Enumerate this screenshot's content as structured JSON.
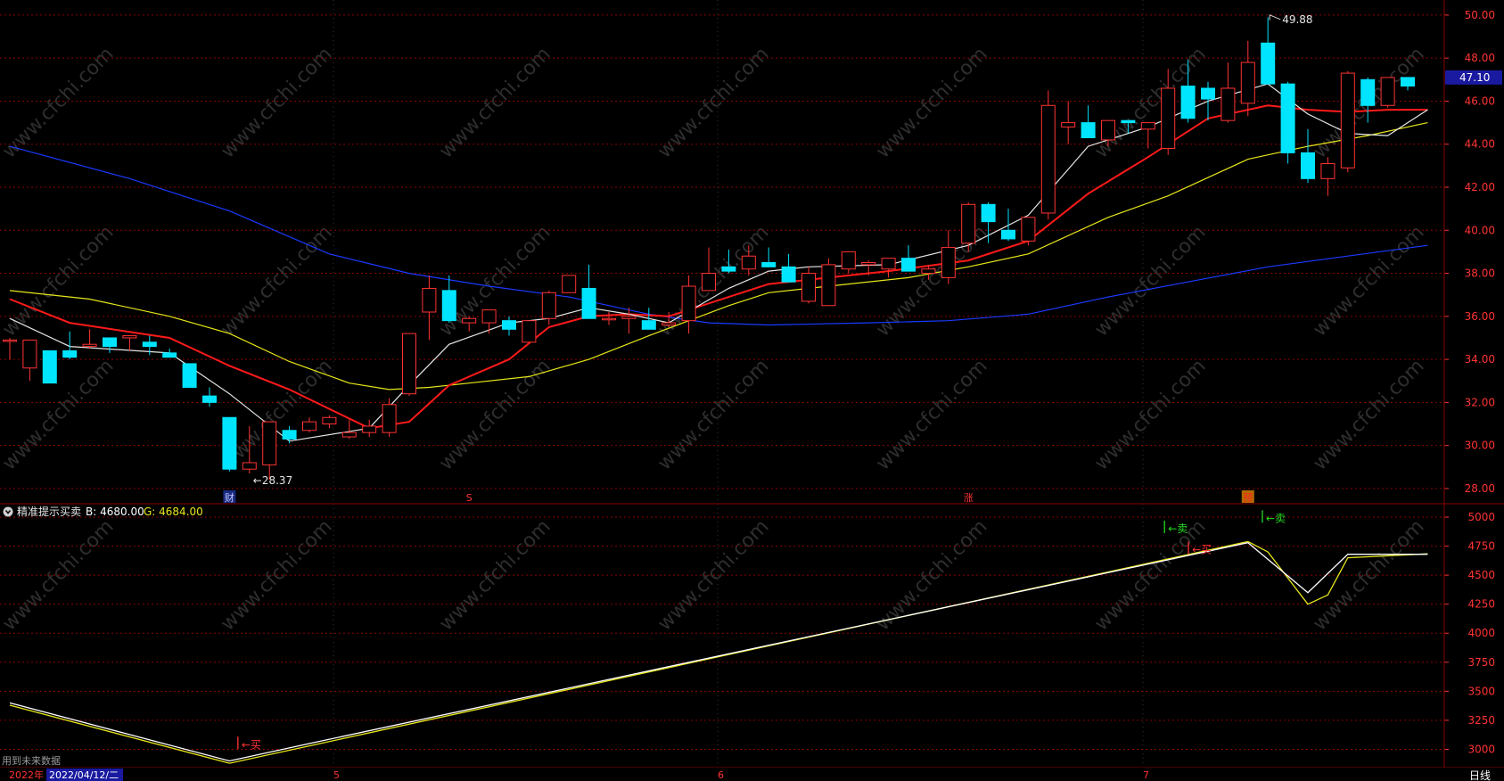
{
  "indicator": {
    "name": "精准提示买卖",
    "b_label": "B: 4680.00",
    "g_label": "G: 4684.00",
    "future_note": "用到未来数据"
  },
  "time_bar": {
    "year": "2022年",
    "cursor_date": "2022/04/12/二",
    "period": "日线",
    "months": [
      "5",
      "6",
      "7"
    ]
  },
  "price_panel": {
    "yticks": [
      "50.00",
      "48.00",
      "46.00",
      "44.00",
      "42.00",
      "40.00",
      "38.00",
      "36.00",
      "34.00",
      "32.00",
      "30.00",
      "28.00"
    ],
    "current_price": "47.10",
    "high_label": "49.88",
    "low_label": "←28.37",
    "markers": [
      "财",
      "S",
      "涨",
      "预"
    ]
  },
  "indicator_panel": {
    "yticks": [
      "5000",
      "4750",
      "4500",
      "4250",
      "4000",
      "3750",
      "3500",
      "3250",
      "3000"
    ],
    "signals": [
      {
        "text": "←买",
        "color": "#ff3333"
      },
      {
        "text": "←卖",
        "color": "#22dd22"
      },
      {
        "text": "←卖",
        "color": "#22dd22"
      },
      {
        "text": "←买",
        "color": "#ff3333"
      }
    ]
  },
  "watermark": "www.cfchi.com",
  "colors": {
    "up": "#ff3333",
    "down": "#00e5ff",
    "ma_white": "#e6e6e6",
    "ma_red": "#ff1a1a",
    "ma_yellow": "#e6e61a",
    "ma_blue": "#1a3aff",
    "grid": "#8b0000",
    "axis_text": "#ff3333",
    "b_line": "#ffffff",
    "g_line": "#e6e61a"
  },
  "chart_data": [
    {
      "type": "candlestick",
      "title": "",
      "ylim": [
        27.5,
        50.7
      ],
      "candles_ohlc": [
        [
          34.9,
          35.0,
          34.0,
          34.9
        ],
        [
          33.6,
          34.7,
          33.0,
          34.9
        ],
        [
          34.4,
          34.4,
          32.9,
          32.9
        ],
        [
          34.4,
          35.3,
          34.0,
          34.1
        ],
        [
          34.6,
          35.4,
          34.5,
          34.7
        ],
        [
          35.0,
          35.0,
          34.3,
          34.6
        ],
        [
          35.0,
          35.1,
          34.4,
          35.1
        ],
        [
          34.8,
          35.1,
          34.2,
          34.6
        ],
        [
          34.3,
          34.5,
          34.1,
          34.1
        ],
        [
          33.8,
          33.8,
          32.7,
          32.7
        ],
        [
          32.3,
          32.7,
          31.8,
          32.0
        ],
        [
          31.3,
          31.3,
          28.8,
          28.9
        ],
        [
          28.9,
          30.9,
          28.7,
          29.2
        ],
        [
          29.1,
          31.1,
          28.4,
          31.1
        ],
        [
          30.7,
          30.9,
          30.1,
          30.3
        ],
        [
          30.7,
          31.3,
          30.6,
          31.1
        ],
        [
          31.0,
          31.4,
          30.8,
          31.3
        ],
        [
          30.4,
          31.2,
          30.3,
          30.6
        ],
        [
          30.6,
          31.2,
          30.4,
          30.9
        ],
        [
          30.6,
          32.2,
          30.4,
          31.9
        ],
        [
          32.4,
          35.2,
          32.3,
          35.2
        ],
        [
          36.2,
          37.9,
          34.9,
          37.3
        ],
        [
          37.2,
          37.9,
          35.7,
          35.8
        ],
        [
          35.7,
          36.0,
          35.3,
          35.9
        ],
        [
          35.7,
          36.2,
          35.2,
          36.3
        ],
        [
          35.8,
          36.0,
          35.1,
          35.4
        ],
        [
          34.8,
          35.8,
          34.8,
          35.8
        ],
        [
          35.9,
          37.2,
          35.6,
          37.1
        ],
        [
          37.1,
          37.9,
          37.1,
          37.9
        ],
        [
          37.3,
          38.4,
          35.9,
          35.9
        ],
        [
          35.9,
          36.2,
          35.6,
          35.9
        ],
        [
          35.9,
          36.4,
          35.2,
          36.0
        ],
        [
          35.8,
          36.4,
          35.4,
          35.4
        ],
        [
          35.6,
          36.2,
          35.5,
          35.7
        ],
        [
          35.8,
          37.9,
          35.2,
          37.4
        ],
        [
          37.2,
          39.2,
          37.2,
          38.0
        ],
        [
          38.3,
          39.1,
          38.0,
          38.1
        ],
        [
          38.2,
          39.3,
          37.9,
          38.8
        ],
        [
          38.5,
          39.2,
          38.3,
          38.3
        ],
        [
          38.3,
          38.9,
          37.6,
          37.6
        ],
        [
          36.7,
          38.3,
          36.6,
          38.0
        ],
        [
          36.5,
          38.7,
          36.5,
          38.4
        ],
        [
          38.2,
          39.0,
          38.0,
          39.0
        ],
        [
          38.4,
          38.6,
          37.9,
          38.5
        ],
        [
          38.2,
          38.6,
          37.8,
          38.7
        ],
        [
          38.7,
          39.3,
          38.1,
          38.1
        ],
        [
          38.0,
          38.4,
          37.7,
          38.2
        ],
        [
          37.8,
          40.0,
          37.5,
          39.2
        ],
        [
          39.4,
          41.3,
          39.0,
          41.2
        ],
        [
          41.2,
          41.3,
          39.4,
          40.4
        ],
        [
          40.0,
          41.0,
          39.5,
          39.6
        ],
        [
          39.5,
          40.6,
          39.3,
          40.6
        ],
        [
          40.8,
          46.5,
          40.5,
          45.8
        ],
        [
          44.8,
          46.0,
          44.0,
          45.0
        ],
        [
          45.0,
          45.8,
          44.3,
          44.3
        ],
        [
          44.2,
          45.1,
          43.9,
          45.1
        ],
        [
          45.1,
          45.1,
          44.5,
          45.0
        ],
        [
          44.7,
          44.9,
          43.8,
          45.0
        ],
        [
          43.8,
          47.5,
          43.5,
          46.6
        ],
        [
          46.7,
          47.9,
          45.0,
          45.2
        ],
        [
          46.6,
          46.9,
          45.1,
          46.1
        ],
        [
          45.1,
          47.8,
          45.0,
          46.6
        ],
        [
          45.9,
          48.8,
          45.3,
          47.8
        ],
        [
          48.7,
          49.9,
          46.8,
          46.8
        ],
        [
          46.8,
          46.9,
          43.1,
          43.6
        ],
        [
          43.6,
          44.7,
          42.2,
          42.4
        ],
        [
          42.4,
          43.4,
          41.6,
          43.1
        ],
        [
          42.9,
          47.4,
          42.7,
          47.3
        ],
        [
          47.0,
          47.1,
          45.0,
          45.8
        ],
        [
          45.8,
          47.1,
          45.7,
          47.1
        ],
        [
          47.1,
          47.1,
          46.5,
          46.7
        ]
      ],
      "ma_white": [
        [
          0,
          35.9
        ],
        [
          3,
          34.6
        ],
        [
          8,
          34.3
        ],
        [
          11,
          32.4
        ],
        [
          14,
          30.2
        ],
        [
          18,
          30.8
        ],
        [
          20,
          32.8
        ],
        [
          22,
          34.7
        ],
        [
          25,
          35.7
        ],
        [
          27,
          35.9
        ],
        [
          29,
          36.4
        ],
        [
          31,
          36.1
        ],
        [
          33,
          35.7
        ],
        [
          36,
          37.3
        ],
        [
          38,
          38.1
        ],
        [
          40,
          38.3
        ],
        [
          44,
          38.4
        ],
        [
          48,
          39.3
        ],
        [
          51,
          40.7
        ],
        [
          54,
          43.9
        ],
        [
          57,
          44.8
        ],
        [
          60,
          46.0
        ],
        [
          63,
          46.8
        ],
        [
          65,
          45.4
        ],
        [
          67,
          44.5
        ],
        [
          69,
          44.4
        ],
        [
          71,
          45.6
        ]
      ],
      "ma_red": [
        [
          0,
          36.8
        ],
        [
          3,
          35.7
        ],
        [
          8,
          35.0
        ],
        [
          11,
          33.7
        ],
        [
          14,
          32.6
        ],
        [
          18,
          30.8
        ],
        [
          20,
          31.1
        ],
        [
          22,
          32.8
        ],
        [
          25,
          34.0
        ],
        [
          27,
          35.5
        ],
        [
          29,
          36.0
        ],
        [
          31,
          36.1
        ],
        [
          33,
          36.0
        ],
        [
          36,
          36.9
        ],
        [
          38,
          37.5
        ],
        [
          40,
          37.7
        ],
        [
          44,
          38.1
        ],
        [
          48,
          38.6
        ],
        [
          51,
          39.5
        ],
        [
          54,
          41.7
        ],
        [
          57,
          43.4
        ],
        [
          60,
          45.2
        ],
        [
          63,
          45.8
        ],
        [
          65,
          45.6
        ],
        [
          67,
          45.5
        ],
        [
          69,
          45.6
        ],
        [
          71,
          45.6
        ]
      ],
      "ma_yellow": [
        [
          0,
          37.2
        ],
        [
          4,
          36.8
        ],
        [
          8,
          36.0
        ],
        [
          11,
          35.2
        ],
        [
          14,
          33.9
        ],
        [
          17,
          32.9
        ],
        [
          19,
          32.6
        ],
        [
          21,
          32.7
        ],
        [
          23,
          32.9
        ],
        [
          26,
          33.2
        ],
        [
          29,
          34.0
        ],
        [
          32,
          35.1
        ],
        [
          34,
          35.8
        ],
        [
          36,
          36.5
        ],
        [
          38,
          37.1
        ],
        [
          41,
          37.4
        ],
        [
          45,
          37.8
        ],
        [
          48,
          38.3
        ],
        [
          51,
          38.9
        ],
        [
          55,
          40.6
        ],
        [
          58,
          41.6
        ],
        [
          62,
          43.3
        ],
        [
          65,
          43.9
        ],
        [
          68,
          44.4
        ],
        [
          71,
          45.0
        ]
      ],
      "ma_blue": [
        [
          0,
          43.9
        ],
        [
          6,
          42.4
        ],
        [
          11,
          40.9
        ],
        [
          16,
          38.9
        ],
        [
          20,
          38.0
        ],
        [
          24,
          37.4
        ],
        [
          28,
          36.9
        ],
        [
          32,
          36.1
        ],
        [
          35,
          35.7
        ],
        [
          38,
          35.6
        ],
        [
          43,
          35.7
        ],
        [
          47,
          35.8
        ],
        [
          51,
          36.1
        ],
        [
          55,
          36.9
        ],
        [
          59,
          37.6
        ],
        [
          63,
          38.3
        ],
        [
          67,
          38.8
        ],
        [
          71,
          39.3
        ]
      ]
    },
    {
      "type": "line",
      "title": "精准提示买卖",
      "ylim": [
        2850,
        5100
      ],
      "series": [
        {
          "name": "B",
          "values": [
            [
              0,
              3400
            ],
            [
              11,
              2900
            ],
            [
              15,
              3050
            ],
            [
              62,
              4780
            ],
            [
              65,
              4350
            ],
            [
              67,
              4680
            ],
            [
              71,
              4680
            ]
          ]
        },
        {
          "name": "G",
          "values": [
            [
              0,
              3380
            ],
            [
              11,
              2880
            ],
            [
              15,
              3030
            ],
            [
              62,
              4790
            ],
            [
              63,
              4700
            ],
            [
              65,
              4250
            ],
            [
              66,
              4330
            ],
            [
              67,
              4650
            ],
            [
              71,
              4684
            ]
          ]
        }
      ]
    }
  ]
}
